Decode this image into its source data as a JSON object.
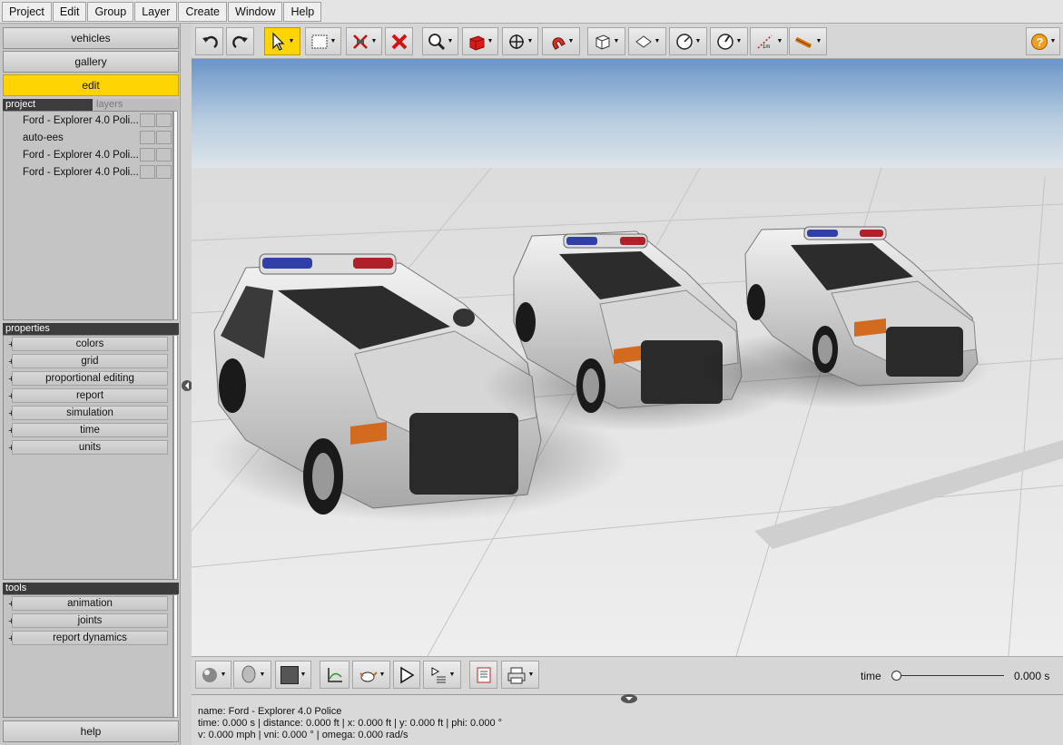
{
  "menubar": {
    "items": [
      "Project",
      "Edit",
      "Group",
      "Layer",
      "Create",
      "Window",
      "Help"
    ]
  },
  "nav": {
    "vehicles": "vehicles",
    "gallery": "gallery",
    "edit": "edit",
    "help": "help"
  },
  "project_panel": {
    "tab_project": "project",
    "tab_layers": "layers",
    "items": [
      "Ford - Explorer 4.0 Poli...",
      "auto-ees",
      "Ford - Explorer 4.0 Poli...",
      "Ford - Explorer 4.0 Poli..."
    ]
  },
  "properties": {
    "title": "properties",
    "items": [
      "colors",
      "grid",
      "proportional editing",
      "report",
      "simulation",
      "time",
      "units"
    ]
  },
  "tools": {
    "title": "tools",
    "items": [
      "animation",
      "joints",
      "report dynamics"
    ]
  },
  "time_control": {
    "label": "time",
    "value": "0.000 s"
  },
  "status": {
    "line1": "name: Ford - Explorer 4.0 Police",
    "line2": "time: 0.000 s | distance: 0.000 ft | x: 0.000 ft | y: 0.000 ft | phi: 0.000 °",
    "line3": "v: 0.000 mph | vni: 0.000 ° | omega: 0.000 rad/s"
  },
  "toolbar_icons": [
    "undo-icon",
    "redo-icon",
    "select-arrow-icon",
    "rectangle-select-icon",
    "cut-icon",
    "delete-icon",
    "zoom-icon",
    "object-icon",
    "move-icon",
    "magnet-icon",
    "box-view-icon",
    "plane-view-icon",
    "angle-icon",
    "gauge-icon",
    "measure-icon",
    "ruler-icon",
    "help-icon"
  ],
  "colors": {
    "accent": "#ffd400",
    "panel": "#c8c8c8",
    "dark_header": "#3c3c3c"
  }
}
